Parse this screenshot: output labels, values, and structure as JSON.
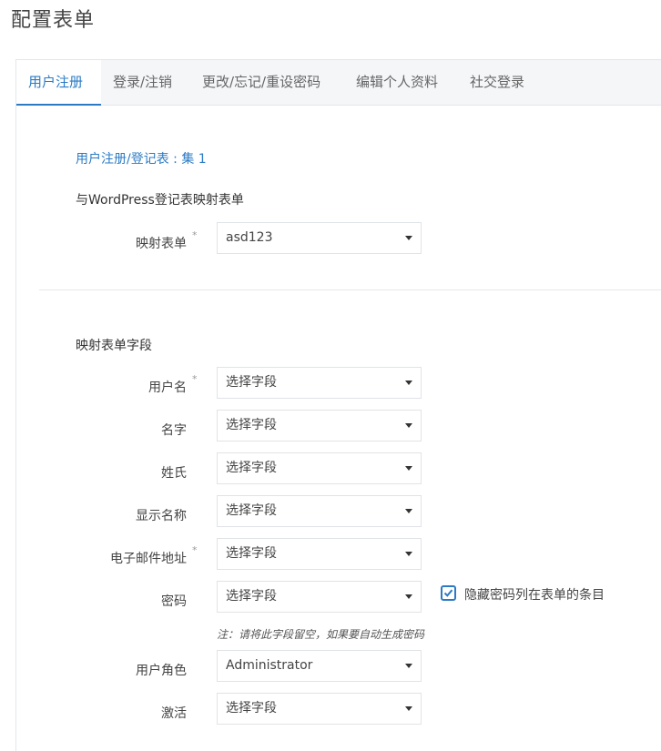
{
  "page": {
    "title": "配置表单"
  },
  "tabs": [
    {
      "label": "用户注册",
      "active": true
    },
    {
      "label": "登录/注销",
      "active": false
    },
    {
      "label": "更改/忘记/重设密码",
      "active": false
    },
    {
      "label": "编辑个人资料",
      "active": false
    },
    {
      "label": "社交登录",
      "active": false
    }
  ],
  "section": {
    "link": "用户注册/登记表 : 集 1",
    "map_heading": "与WordPress登记表映射表单",
    "fields_heading": "映射表单字段",
    "required_mark": "*"
  },
  "mapping_form": {
    "label": "映射表单",
    "value": "asd123",
    "required": true
  },
  "fields": [
    {
      "label": "用户名",
      "value": "选择字段",
      "required": true
    },
    {
      "label": "名字",
      "value": "选择字段",
      "required": false
    },
    {
      "label": "姓氏",
      "value": "选择字段",
      "required": false
    },
    {
      "label": "显示名称",
      "value": "选择字段",
      "required": false
    },
    {
      "label": "电子邮件地址",
      "value": "选择字段",
      "required": true
    },
    {
      "label": "密码",
      "value": "选择字段",
      "required": false
    },
    {
      "label": "用户角色",
      "value": "Administrator",
      "required": false
    },
    {
      "label": "激活",
      "value": "选择字段",
      "required": false
    }
  ],
  "password_option": {
    "label": "隐藏密码列在表单的条目",
    "checked": true
  },
  "password_note": "注：请将此字段留空，如果要自动生成密码",
  "colors": {
    "accent": "#2b7bc4",
    "tab_bar": "#f4f6f8",
    "border": "#e0e3e7"
  }
}
